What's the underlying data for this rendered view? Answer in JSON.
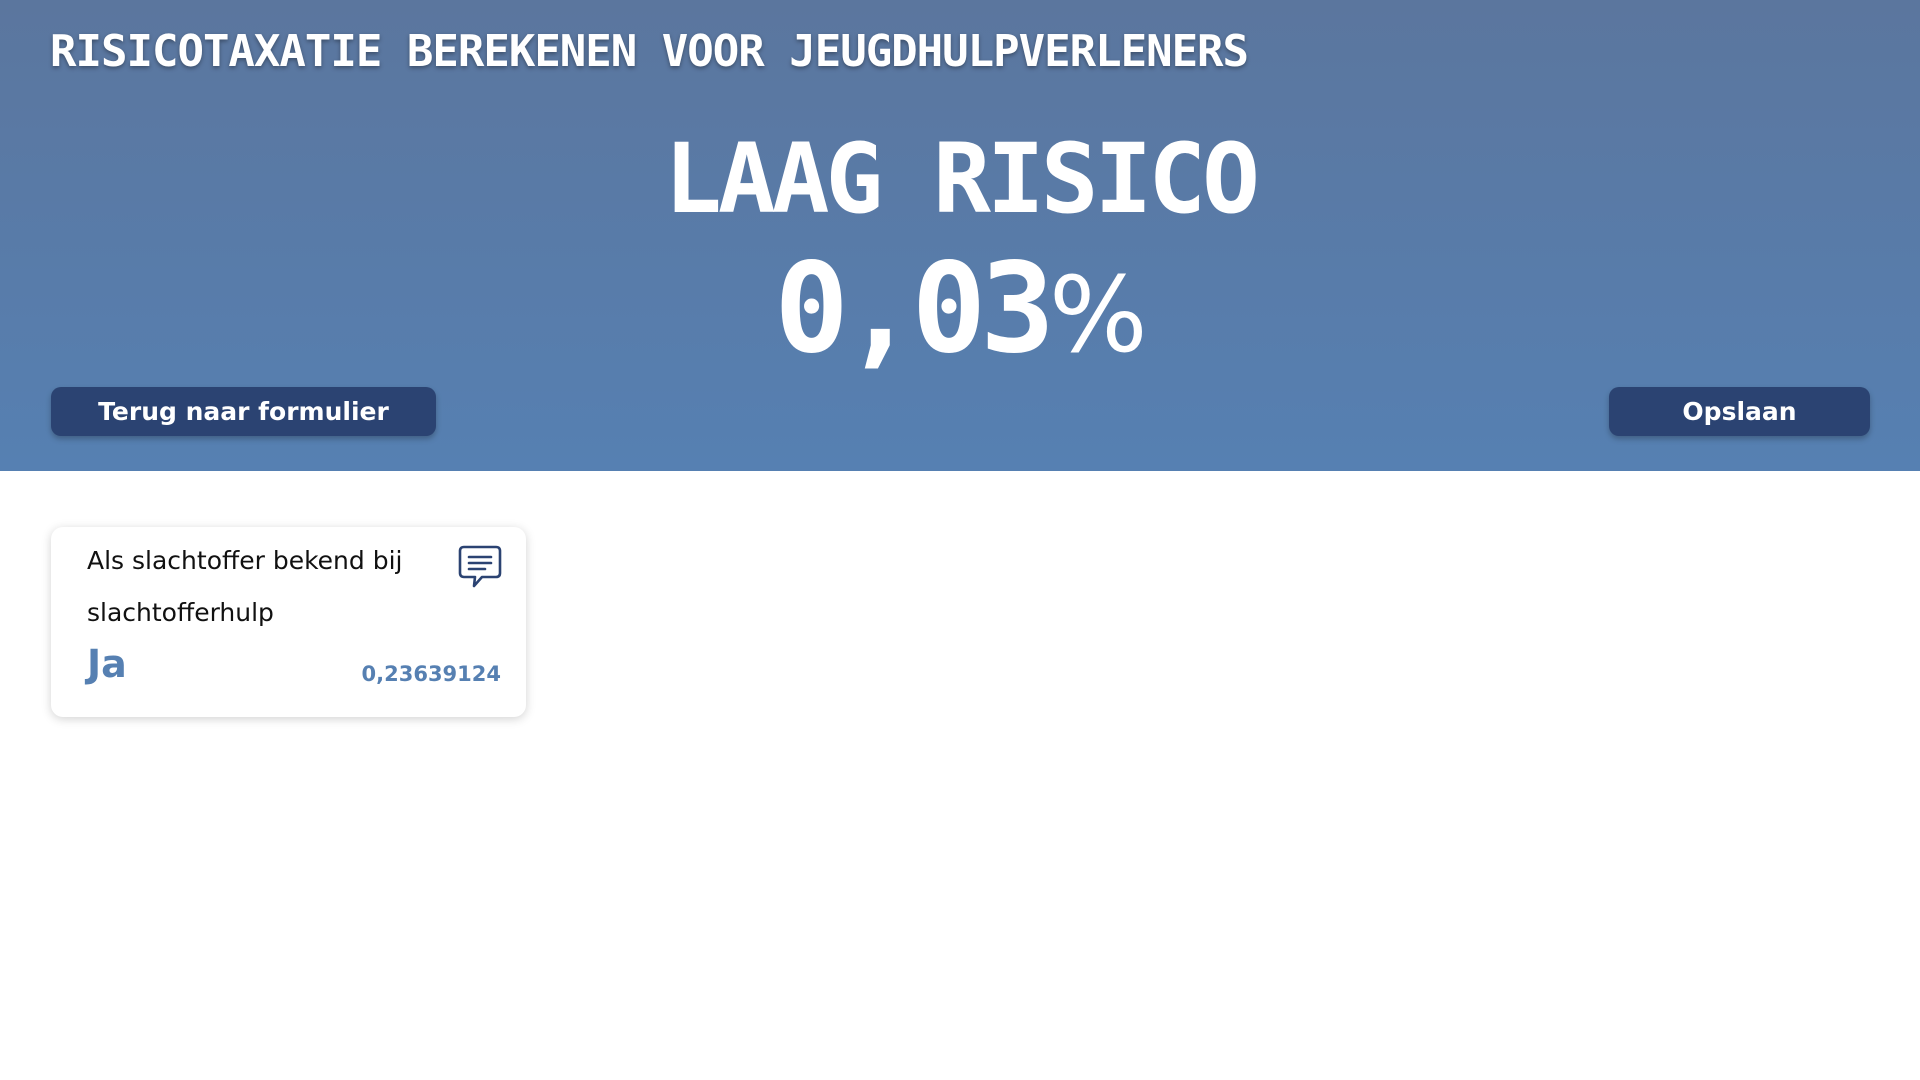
{
  "header": {
    "title": "RISICOTAXATIE BEREKENEN VOOR JEUGDHULPVERLENERS"
  },
  "result": {
    "risk_level": "LAAG RISICO",
    "risk_value": "0,03",
    "risk_unit": "%"
  },
  "actions": {
    "back_label": "Terug naar formulier",
    "save_label": "Opslaan"
  },
  "factors": [
    {
      "label": "Als slachtoffer bekend bij slachtofferhulp",
      "answer": "Ja",
      "score": "0,23639124",
      "icon": "comment-icon"
    }
  ],
  "colors": {
    "hero_top": "#5b769e",
    "hero_bottom": "#5680b2",
    "button": "#2b4372",
    "accent": "#5680b2"
  }
}
